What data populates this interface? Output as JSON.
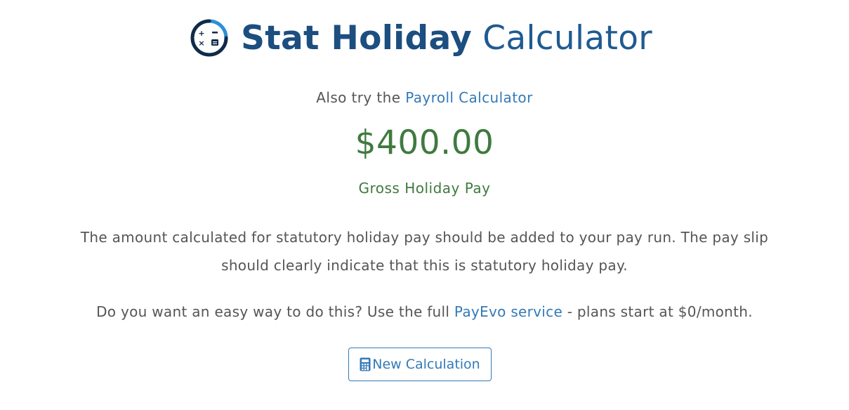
{
  "header": {
    "logo_icon": "calculator-gauge-icon",
    "title_bold": "Stat Holiday",
    "title_light": "Calculator"
  },
  "also_try": {
    "prefix": "Also try the ",
    "link_label": "Payroll Calculator"
  },
  "result": {
    "amount": "$400.00",
    "label": "Gross Holiday Pay"
  },
  "info_text": "The amount calculated for statutory holiday pay should be added to your pay run. The pay slip should clearly indicate that this is statutory holiday pay.",
  "promo": {
    "prefix": "Do you want an easy way to do this? Use the full ",
    "link_label": "PayEvo service",
    "suffix": " - plans start at $0/month."
  },
  "new_calc_button": {
    "icon": "calculator-icon",
    "label": "New Calculation"
  },
  "colors": {
    "title": "#1c4e80",
    "link": "#337ab7",
    "amount": "#3f7a3f",
    "text": "#555555"
  }
}
